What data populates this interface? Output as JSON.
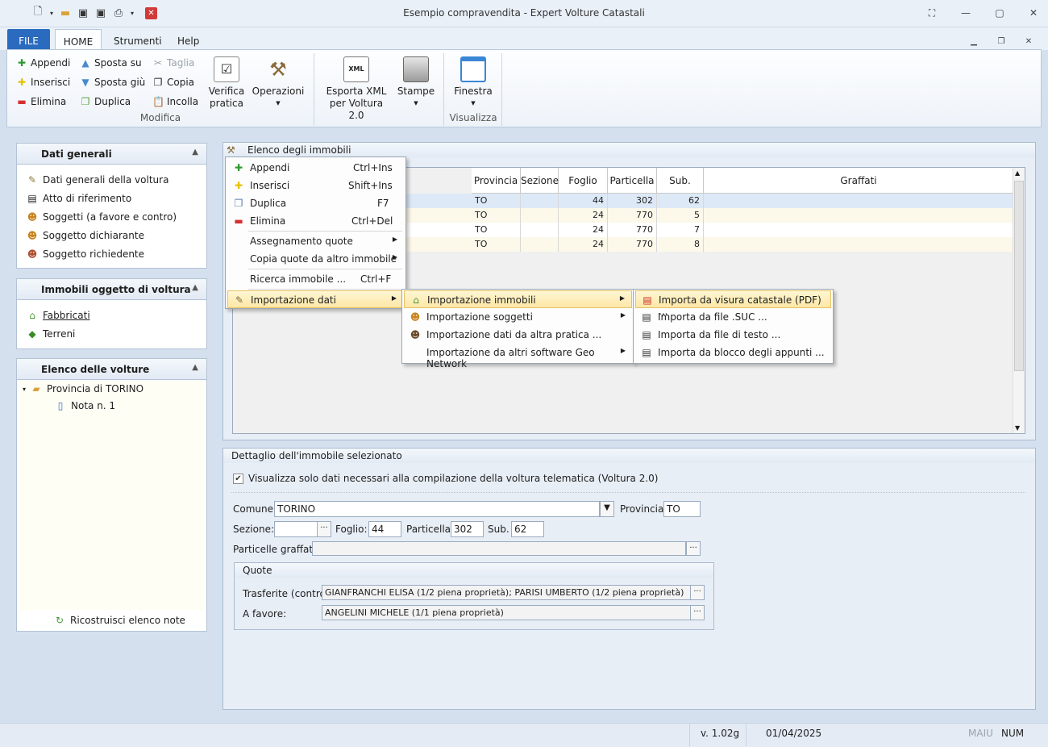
{
  "window": {
    "title": "Esempio compravendita - Expert Volture Catastali"
  },
  "tabs": {
    "file": "FILE",
    "home": "HOME",
    "tools": "Strumenti",
    "help": "Help"
  },
  "ribbon": {
    "append": "Appendi",
    "insert": "Inserisci",
    "delete": "Elimina",
    "move_up": "Sposta su",
    "move_down": "Sposta giù",
    "duplicate": "Duplica",
    "cut": "Taglia",
    "copy": "Copia",
    "paste": "Incolla",
    "verify_l1": "Verifica",
    "verify_l2": "pratica",
    "operations": "Operazioni",
    "export_l1": "Esporta XML",
    "export_l2": "per Voltura 2.0",
    "print": "Stampe",
    "window": "Finestra",
    "group_modifica": "Modifica",
    "group_visualizza": "Visualizza"
  },
  "left": {
    "general_title": "Dati generali",
    "general_items": [
      "Dati generali della voltura",
      "Atto di riferimento",
      "Soggetti (a favore e contro)",
      "Soggetto dichiarante",
      "Soggetto richiedente"
    ],
    "immobili_title": "Immobili oggetto di voltura",
    "immobili_items": [
      "Fabbricati",
      "Terreni"
    ],
    "volture_title": "Elenco delle volture",
    "tree_root": "Provincia di TORINO",
    "tree_child": "Nota n. 1",
    "rebuild": "Ricostruisci elenco note"
  },
  "grid": {
    "title": "Elenco degli immobili",
    "columns": [
      "Provincia",
      "Sezione",
      "Foglio",
      "Particella",
      "Sub.",
      "Graffati"
    ],
    "rows": [
      {
        "provincia": "TO",
        "sezione": "",
        "foglio": "44",
        "particella": "302",
        "sub": "62",
        "graffati": ""
      },
      {
        "provincia": "TO",
        "sezione": "",
        "foglio": "24",
        "particella": "770",
        "sub": "5",
        "graffati": ""
      },
      {
        "provincia": "TO",
        "sezione": "",
        "foglio": "24",
        "particella": "770",
        "sub": "7",
        "graffati": ""
      },
      {
        "provincia": "TO",
        "sezione": "",
        "foglio": "24",
        "particella": "770",
        "sub": "8",
        "graffati": ""
      }
    ]
  },
  "detail": {
    "title": "Dettaglio dell'immobile selezionato",
    "checkbox_label": "Visualizza solo dati necessari alla compilazione della voltura telematica (Voltura 2.0)",
    "comune_label": "Comune:",
    "comune_value": "TORINO",
    "provincia_label": "Provincia:",
    "provincia_value": "TO",
    "sezione_label": "Sezione:",
    "sezione_value": "",
    "foglio_label": "Foglio:",
    "foglio_value": "44",
    "particella_label": "Particella:",
    "particella_value": "302",
    "sub_label": "Sub.",
    "sub_value": "62",
    "graffate_label": "Particelle graffate:",
    "graffate_value": "",
    "quote_title": "Quote",
    "contro_label": "Trasferite (contro):",
    "contro_value": "GIANFRANCHI ELISA (1/2 piena proprietà); PARISI UMBERTO (1/2 piena proprietà)",
    "favore_label": "A favore:",
    "favore_value": "ANGELINI MICHELE (1/1 piena proprietà)"
  },
  "context_menu": {
    "items": [
      {
        "label": "Appendi",
        "shortcut": "Ctrl+Ins"
      },
      {
        "label": "Inserisci",
        "shortcut": "Shift+Ins"
      },
      {
        "label": "Duplica",
        "shortcut": "F7"
      },
      {
        "label": "Elimina",
        "shortcut": "Ctrl+Del"
      },
      {
        "label": "Assegnamento quote",
        "shortcut": ""
      },
      {
        "label": "Copia quote da altro immobile",
        "shortcut": ""
      },
      {
        "label": "Ricerca immobile ...",
        "shortcut": "Ctrl+F"
      },
      {
        "label": "Importazione dati",
        "shortcut": ""
      }
    ]
  },
  "submenu_import": {
    "items": [
      "Importazione immobili",
      "Importazione soggetti",
      "Importazione dati da altra pratica ...",
      "Importazione da altri software Geo Network"
    ]
  },
  "submenu_immobili": {
    "items": [
      "Importa da visura catastale (PDF) ...",
      "Importa da file .SUC ...",
      "Importa da file di testo ...",
      "Importa da blocco degli appunti ..."
    ]
  },
  "status": {
    "version": "v. 1.02g",
    "date": "01/04/2025",
    "caps": "MAIU",
    "num": "NUM"
  }
}
